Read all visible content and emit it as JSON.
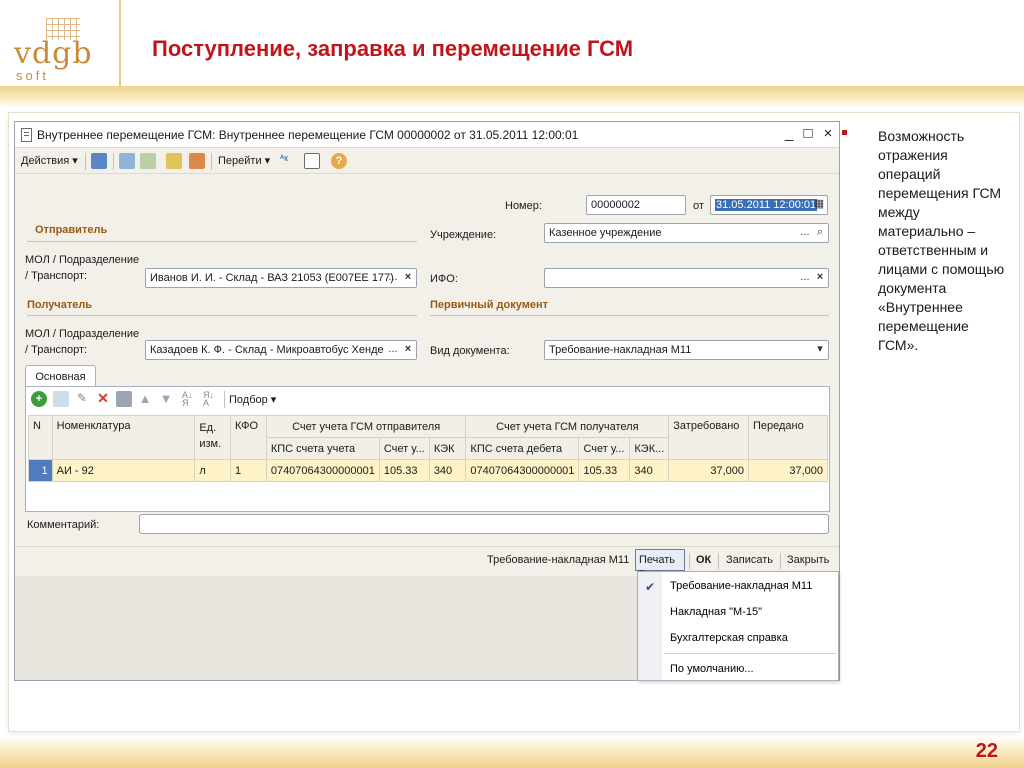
{
  "slide": {
    "title": "Поступление, заправка и перемещение ГСМ",
    "logo_text": "vdgb",
    "logo_sub": "soft",
    "page_number": "22",
    "description": "Возможность отражения операций перемещения ГСМ между материально – ответственным и лицами с помощью документа «Внутреннее перемещение ГСМ»."
  },
  "window": {
    "title": "Внутреннее перемещение ГСМ: Внутреннее перемещение ГСМ 00000002 от 31.05.2011 12:00:01",
    "controls": {
      "minimize": "_",
      "maximize": "□",
      "close": "×"
    }
  },
  "toolbar": {
    "actions": "Действия",
    "goto": "Перейти"
  },
  "header": {
    "number_label": "Номер:",
    "number_value": "00000002",
    "date_label": "от",
    "date_value": "31.05.2011 12:00:01"
  },
  "sender": {
    "section": "Отправитель",
    "mol_label_1": "МОЛ / Подразделение",
    "mol_label_2": "/ Транспорт:",
    "mol_value": "Иванов И. И. - Склад - ВАЗ 21053 (Е007ЕЕ 177)"
  },
  "institution": {
    "label": "Учреждение:",
    "value": "Казенное учреждение",
    "ifo_label": "ИФО:",
    "ifo_value": ""
  },
  "receiver": {
    "section": "Получатель",
    "mol_label_1": "МОЛ / Подразделение",
    "mol_label_2": "/ Транспорт:",
    "mol_value": "Казадоев К. Ф. - Склад - Микроавтобус Хенде"
  },
  "primary_doc": {
    "section": "Первичный документ",
    "type_label": "Вид документа:",
    "type_value": "Требование-накладная М11"
  },
  "tab": {
    "main": "Основная"
  },
  "grid_toolbar": {
    "selection": "Подбор"
  },
  "table": {
    "headers": {
      "n": "N",
      "nomenclature": "Номенклатура",
      "unit_1": "Ед.",
      "unit_2": "изм.",
      "kfo": "КФО",
      "sender_account": "Счет учета ГСМ отправителя",
      "receiver_account": "Счет учета ГСМ получателя",
      "requested": "Затребовано",
      "transferred": "Передано",
      "kps_account": "КПС счета учета",
      "account_short": "Счет у...",
      "kek": "КЭК",
      "kps_debit": "КПС счета дебета",
      "account_short_2": "Счет у...",
      "kek_2": "КЭК..."
    },
    "rows": [
      {
        "n": "1",
        "nomenclature": "АИ - 92",
        "unit": "л",
        "kfo": "1",
        "kps_account": "07407064300000001",
        "account": "105.33",
        "kek": "340",
        "kps_debit": "07407064300000001",
        "account_2": "105.33",
        "kek_2": "340",
        "requested": "37,000",
        "transferred": "37,000"
      }
    ]
  },
  "comment": {
    "label": "Комментарий:",
    "value": ""
  },
  "bottom_bar": {
    "print_form": "Требование-накладная М11",
    "print": "Печать",
    "ok": "ОК",
    "save": "Записать",
    "close": "Закрыть"
  },
  "print_menu": {
    "items": [
      "Требование-накладная М11",
      "Накладная \"М-15\"",
      "Бухгалтерская справка",
      "По умолчанию..."
    ],
    "checked_index": 0
  }
}
